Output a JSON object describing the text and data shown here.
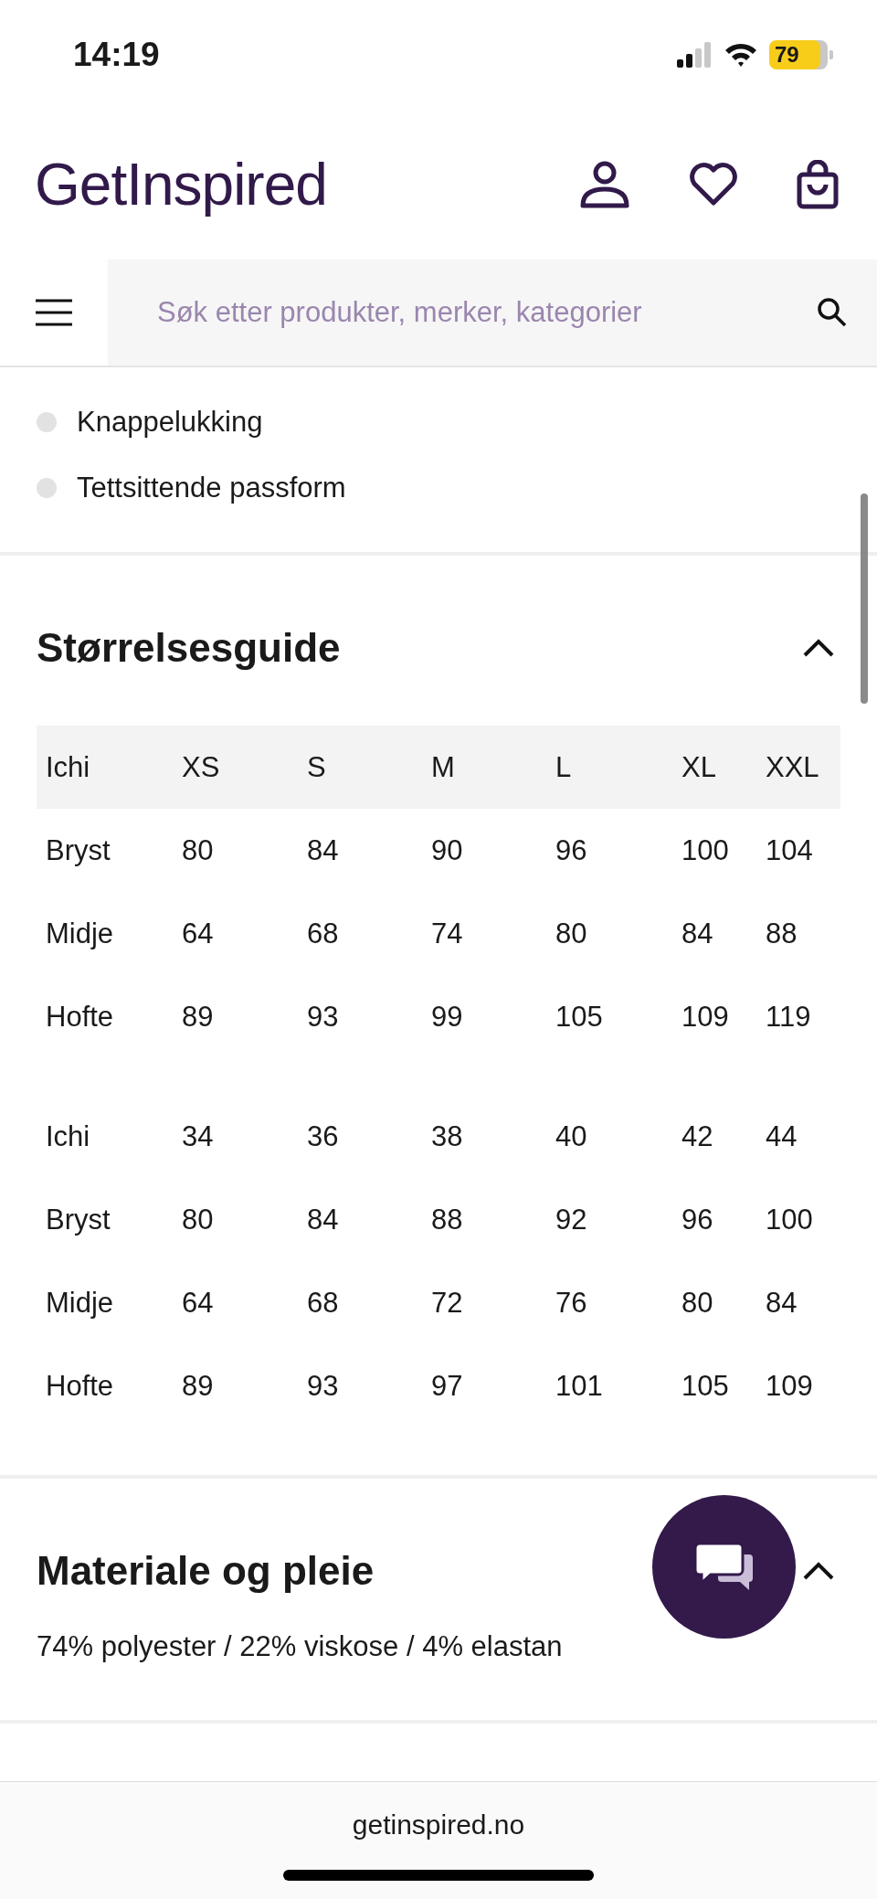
{
  "status_bar": {
    "time": "14:19",
    "battery": "79"
  },
  "header": {
    "logo": "GetInspired"
  },
  "search": {
    "placeholder": "Søk etter produkter, merker, kategorier"
  },
  "features": [
    "Knappelukking",
    "Tettsittende passform"
  ],
  "size_guide": {
    "title": "Størrelsesguide",
    "expanded": true,
    "groups": [
      {
        "rows": [
          {
            "kind": "header",
            "cells": [
              "Ichi",
              "XS",
              "S",
              "M",
              "L",
              "XL",
              "XXL"
            ]
          },
          {
            "kind": "row",
            "cells": [
              "Bryst",
              "80",
              "84",
              "90",
              "96",
              "100",
              "104"
            ]
          },
          {
            "kind": "row",
            "cells": [
              "Midje",
              "64",
              "68",
              "74",
              "80",
              "84",
              "88"
            ]
          },
          {
            "kind": "row",
            "cells": [
              "Hofte",
              "89",
              "93",
              "99",
              "105",
              "109",
              "119"
            ]
          }
        ]
      },
      {
        "rows": [
          {
            "kind": "row",
            "cells": [
              "Ichi",
              "34",
              "36",
              "38",
              "40",
              "42",
              "44"
            ]
          },
          {
            "kind": "row",
            "cells": [
              "Bryst",
              "80",
              "84",
              "88",
              "92",
              "96",
              "100"
            ]
          },
          {
            "kind": "row",
            "cells": [
              "Midje",
              "64",
              "68",
              "72",
              "76",
              "80",
              "84"
            ]
          },
          {
            "kind": "row",
            "cells": [
              "Hofte",
              "89",
              "93",
              "97",
              "101",
              "105",
              "109"
            ]
          }
        ]
      }
    ]
  },
  "material": {
    "title": "Materiale og pleie",
    "expanded": true,
    "text": "74% polyester / 22% viskose / 4% elastan"
  },
  "browser": {
    "url": "getinspired.no"
  }
}
